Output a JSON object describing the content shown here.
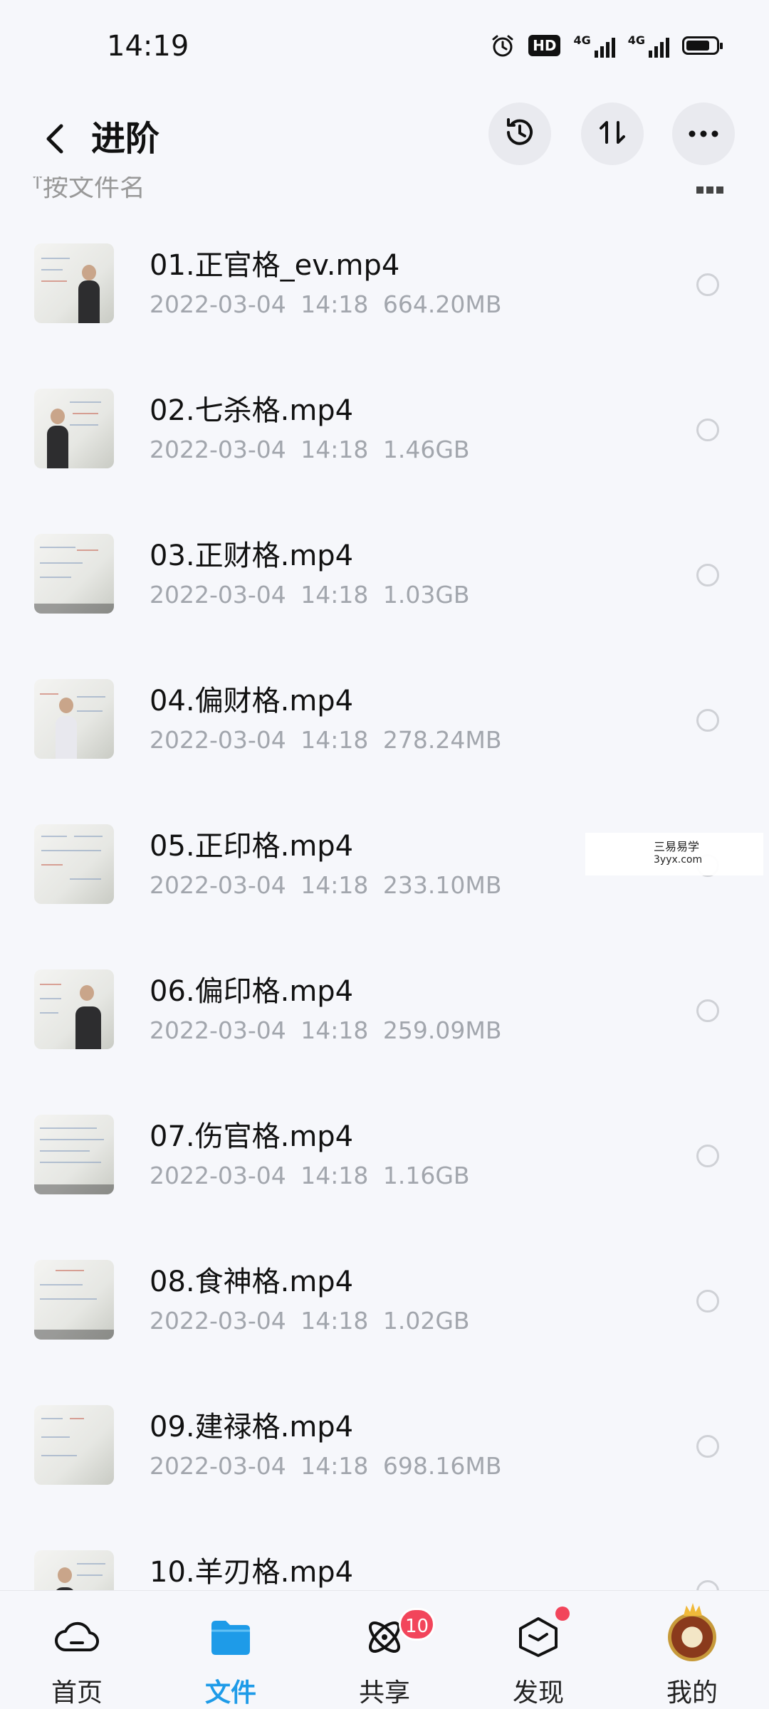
{
  "status_bar": {
    "time": "14:19",
    "hd_label": "HD",
    "network1": "4G",
    "network2": "4G"
  },
  "header": {
    "title": "进阶",
    "icons": [
      "back-arrow",
      "history-clock",
      "sort-arrows",
      "more-dots"
    ]
  },
  "sort_bar": {
    "label": "按文件名",
    "view_toggle": "grid-view"
  },
  "files": [
    {
      "name": "01.正官格_ev.mp4",
      "date": "2022-03-04  14:18",
      "size": "664.20MB"
    },
    {
      "name": "02.七杀格.mp4",
      "date": "2022-03-04  14:18",
      "size": "1.46GB"
    },
    {
      "name": "03.正财格.mp4",
      "date": "2022-03-04  14:18",
      "size": "1.03GB"
    },
    {
      "name": "04.偏财格.mp4",
      "date": "2022-03-04  14:18",
      "size": "278.24MB"
    },
    {
      "name": "05.正印格.mp4",
      "date": "2022-03-04  14:18",
      "size": "233.10MB"
    },
    {
      "name": "06.偏印格.mp4",
      "date": "2022-03-04  14:18",
      "size": "259.09MB"
    },
    {
      "name": "07.伤官格.mp4",
      "date": "2022-03-04  14:18",
      "size": "1.16GB"
    },
    {
      "name": "08.食神格.mp4",
      "date": "2022-03-04  14:18",
      "size": "1.02GB"
    },
    {
      "name": "09.建禄格.mp4",
      "date": "2022-03-04  14:18",
      "size": "698.16MB"
    },
    {
      "name": "10.羊刃格.mp4",
      "date": "",
      "size": ""
    }
  ],
  "watermark": {
    "line1": "三易易学",
    "line2": "3yyx.com"
  },
  "bottom_nav": {
    "items": [
      {
        "label": "首页",
        "icon": "cloud-icon"
      },
      {
        "label": "文件",
        "icon": "folder-icon",
        "active": true
      },
      {
        "label": "共享",
        "icon": "atom-icon",
        "badge": "10"
      },
      {
        "label": "发现",
        "icon": "cube-icon",
        "dot": true
      },
      {
        "label": "我的",
        "icon": "avatar"
      }
    ]
  },
  "colors": {
    "accent": "#1e9be8",
    "badge": "#f2455b",
    "meta_text": "#a2a6ad"
  }
}
